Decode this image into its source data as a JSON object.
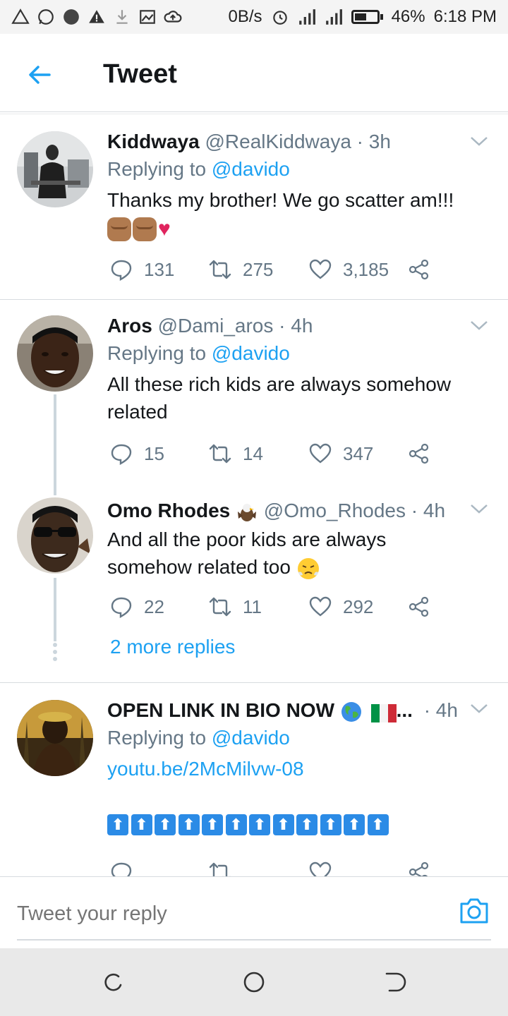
{
  "status_bar": {
    "network_speed": "0B/s",
    "battery_percent": "46%",
    "time": "6:18 PM"
  },
  "header": {
    "title": "Tweet"
  },
  "tweets": [
    {
      "name": "Kiddwaya",
      "handle": "@RealKiddwaya",
      "sep": " · ",
      "time": "3h",
      "replying_prefix": "Replying to ",
      "replying_to": "@davido",
      "text": "Thanks my brother! We go scatter am!!!",
      "replies": "131",
      "retweets": "275",
      "likes": "3,185"
    },
    {
      "name": "Aros",
      "handle": "@Dami_aros",
      "sep": " · ",
      "time": "4h",
      "replying_prefix": "Replying to ",
      "replying_to": "@davido",
      "text_line1": "All these rich kids are always somehow",
      "text_line2": "related",
      "replies": "15",
      "retweets": "14",
      "likes": "347"
    },
    {
      "name": "Omo Rhodes",
      "handle": "@Omo_Rhodes",
      "sep": " · ",
      "time": "4h",
      "text_line1": "And all the poor kids are always",
      "text_line2": "somehow related too",
      "replies": "22",
      "retweets": "11",
      "likes": "292"
    },
    {
      "name": "OPEN LINK IN BIO NOW",
      "name_suffix": "...",
      "sep": " · ",
      "time": "4h",
      "replying_prefix": "Replying to ",
      "replying_to": "@davido",
      "link": "youtu.be/2McMilvw-08",
      "arrow_glyph": "⬆"
    }
  ],
  "more_replies": "2 more replies",
  "reply_bar": {
    "placeholder": "Tweet your reply"
  },
  "colors": {
    "accent": "#1da1f2",
    "muted": "#657786",
    "divider": "#d7dbdf"
  }
}
